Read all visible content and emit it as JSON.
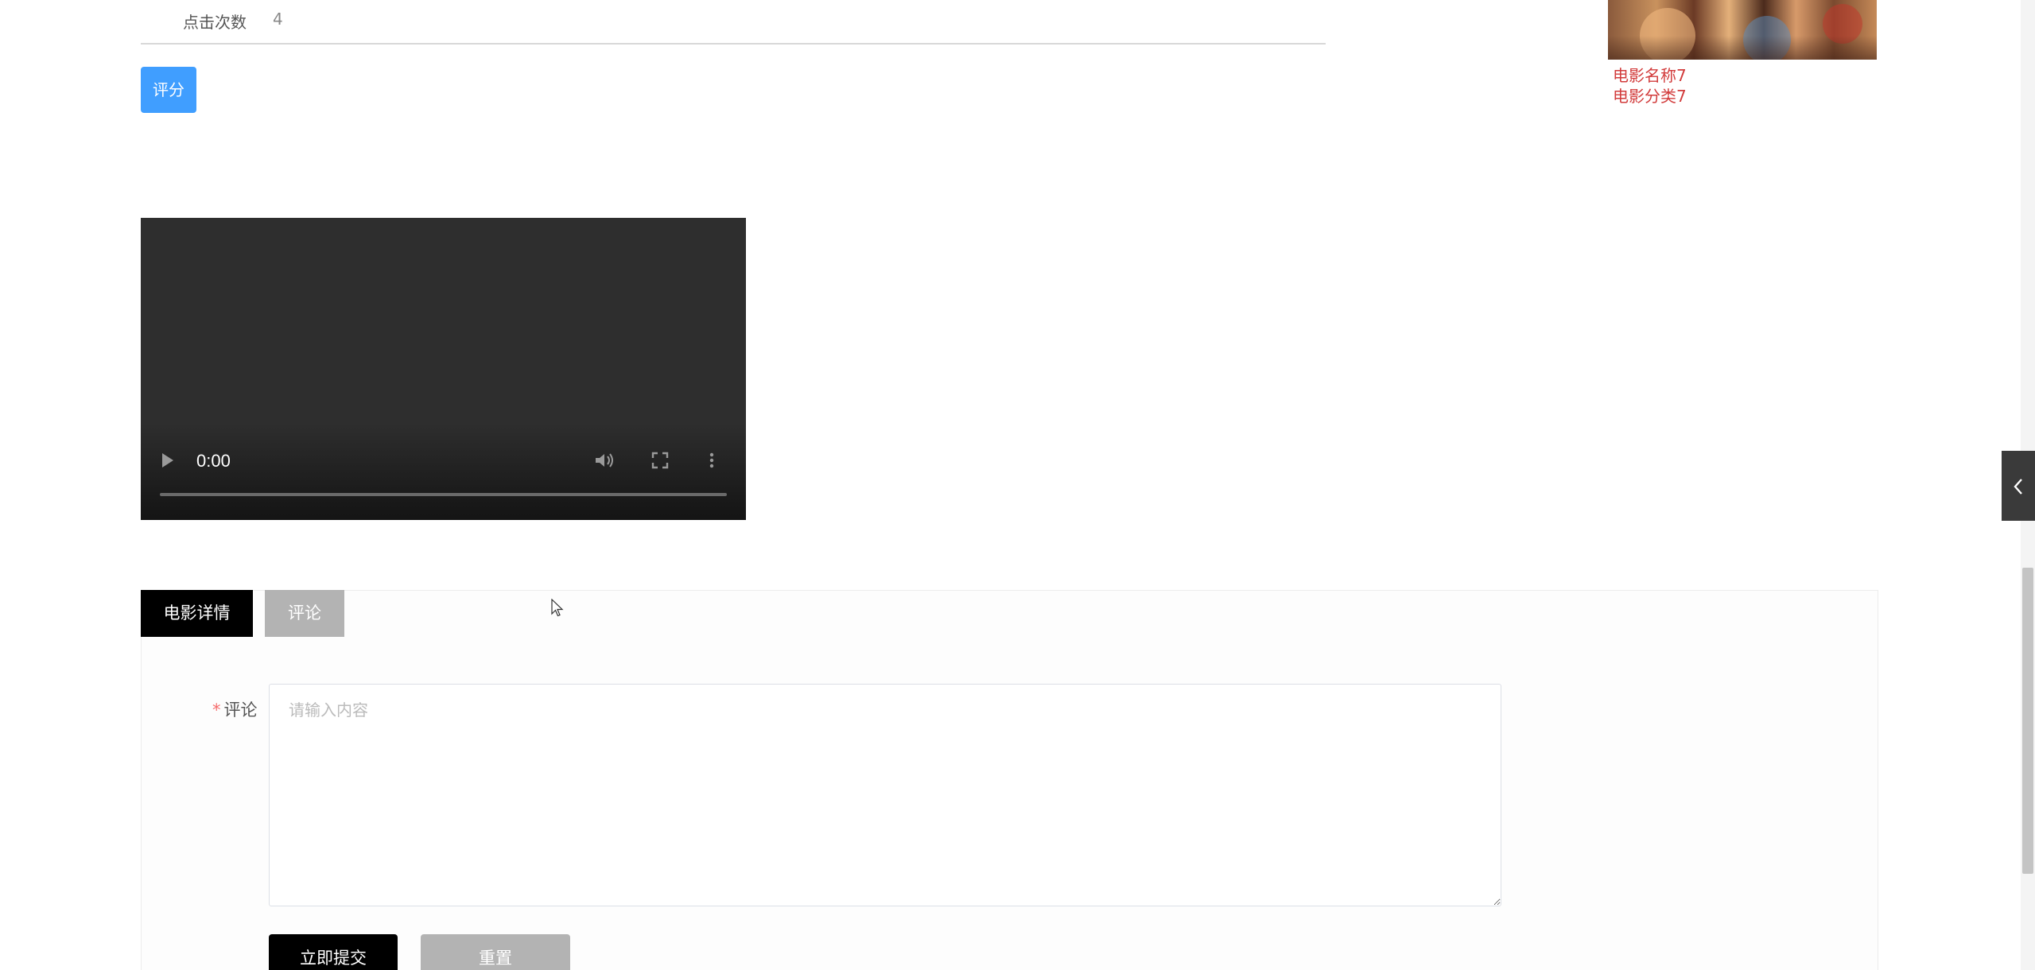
{
  "stats": {
    "click_count_label": "点击次数",
    "click_count_value": "4"
  },
  "rate_button": "评分",
  "movie_card": {
    "name": "电影名称7",
    "category": "电影分类7"
  },
  "video": {
    "time": "0:00",
    "play_icon": "play-icon",
    "volume_icon": "volume-icon",
    "fullscreen_icon": "fullscreen-icon",
    "more_icon": "more-icon",
    "progress": 0
  },
  "side_tab_icon": "chevron-left-icon",
  "tabs": [
    {
      "label": "电影详情",
      "active": true
    },
    {
      "label": "评论",
      "active": false
    }
  ],
  "comment_form": {
    "required_mark": "*",
    "label": "评论",
    "placeholder": "请输入内容",
    "value": "",
    "submit_label": "立即提交",
    "reset_label": "重置"
  },
  "colors": {
    "primary": "#409eff",
    "accent_red": "#d23b3b",
    "active_tab": "#000000",
    "inactive_tab": "#b3b3b3"
  }
}
